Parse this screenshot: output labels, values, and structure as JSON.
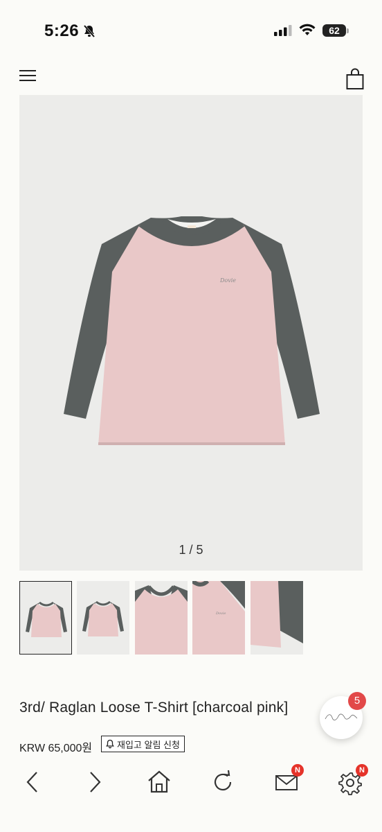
{
  "status_bar": {
    "time": "5:26",
    "battery": "62"
  },
  "gallery": {
    "counter": "1 / 5"
  },
  "product": {
    "title": "3rd/ Raglan Loose T-Shirt [charcoal pink]",
    "price": "KRW 65,000원",
    "restock_button": "재입고 알림 신청"
  },
  "floating_button": {
    "badge_count": "5"
  },
  "bottom_nav": {
    "mail_badge": "N",
    "settings_badge": "N"
  },
  "colors": {
    "body": "#e9c8c8",
    "sleeves": "#5a5f5e",
    "badge_red": "#e24949"
  }
}
